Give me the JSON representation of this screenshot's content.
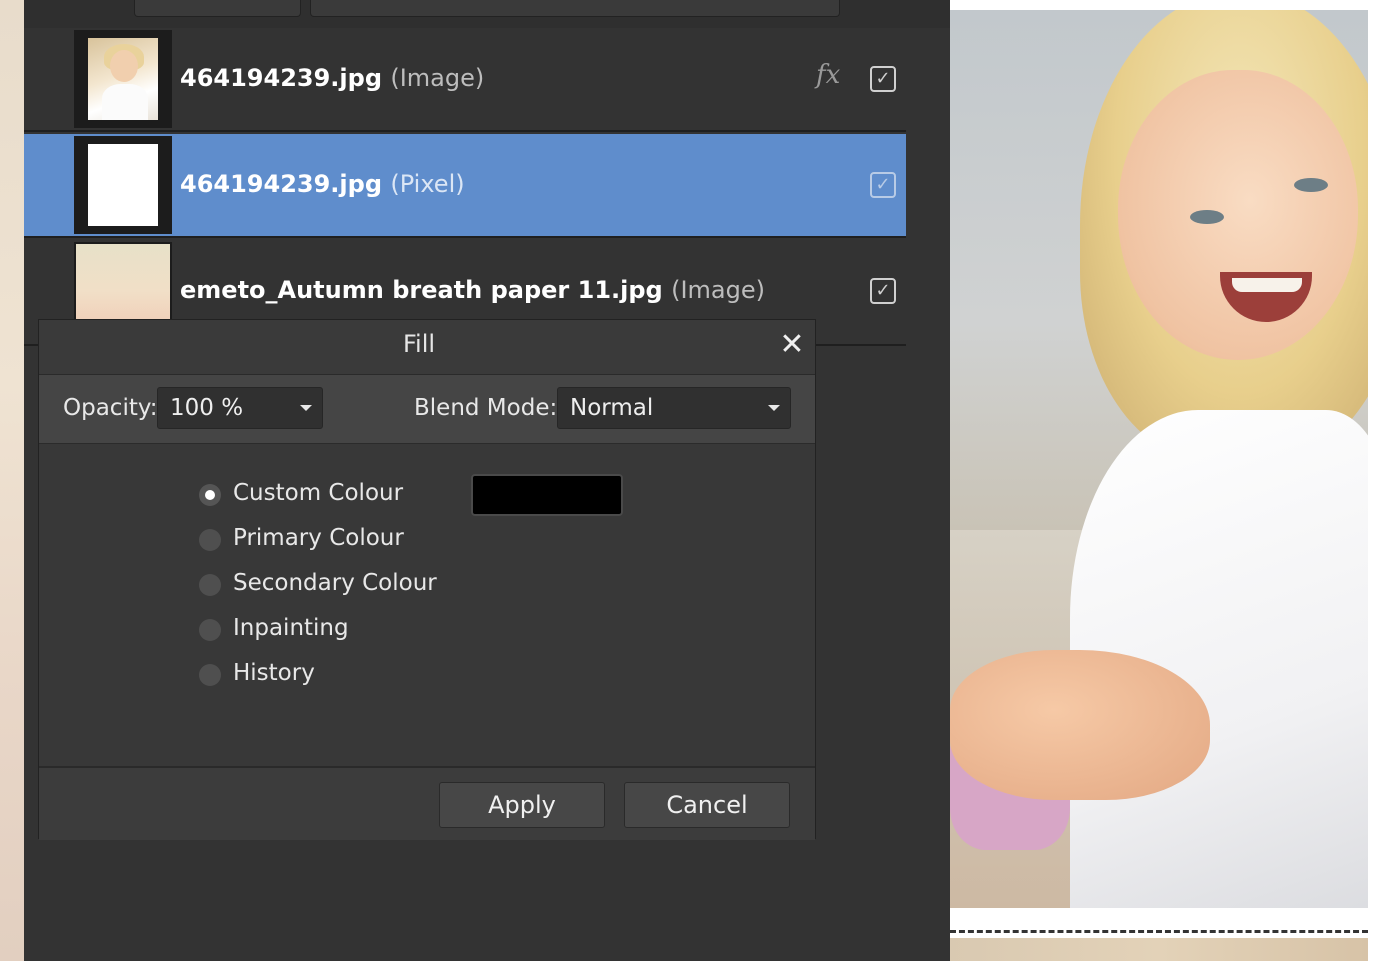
{
  "layers": [
    {
      "name": "464194239.jpg",
      "type": "(Image)",
      "fx": "fx",
      "visible": true,
      "selected": false
    },
    {
      "name": "464194239.jpg",
      "type": "(Pixel)",
      "fx": "",
      "visible": true,
      "selected": true
    },
    {
      "name": "emeto_Autumn breath paper 11.jpg",
      "type": "(Image)",
      "fx": "",
      "visible": true,
      "selected": false
    }
  ],
  "check_glyph": "✓",
  "dialog": {
    "title": "Fill",
    "close_glyph": "✕",
    "opacity_label": "Opacity:",
    "opacity_value": "100 %",
    "blend_label": "Blend Mode:",
    "blend_value": "Normal",
    "fill_options": [
      {
        "label": "Custom Colour",
        "selected": true
      },
      {
        "label": "Primary Colour",
        "selected": false
      },
      {
        "label": "Secondary Colour",
        "selected": false
      },
      {
        "label": "Inpainting",
        "selected": false
      },
      {
        "label": "History",
        "selected": false
      }
    ],
    "custom_color": "#000000",
    "apply_label": "Apply",
    "cancel_label": "Cancel"
  },
  "colors": {
    "panel_bg": "#333333",
    "selection": "#5f8dcc",
    "dialog_bg": "#383838"
  }
}
